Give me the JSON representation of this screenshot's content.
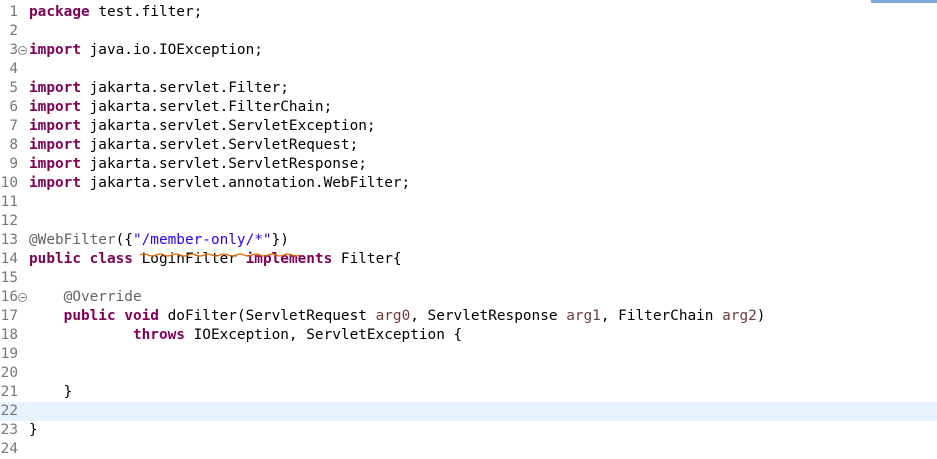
{
  "editor": {
    "lines": [
      {
        "num": "1",
        "fold": false,
        "tokens": [
          {
            "t": "package",
            "c": "kw"
          },
          {
            "t": " test.filter;",
            "c": "plain"
          }
        ]
      },
      {
        "num": "2",
        "fold": false,
        "tokens": []
      },
      {
        "num": "3",
        "fold": true,
        "tokens": [
          {
            "t": "import",
            "c": "kw"
          },
          {
            "t": " java.io.IOException;",
            "c": "plain"
          }
        ]
      },
      {
        "num": "4",
        "fold": false,
        "tokens": []
      },
      {
        "num": "5",
        "fold": false,
        "tokens": [
          {
            "t": "import",
            "c": "kw"
          },
          {
            "t": " jakarta.servlet.Filter;",
            "c": "plain"
          }
        ]
      },
      {
        "num": "6",
        "fold": false,
        "tokens": [
          {
            "t": "import",
            "c": "kw"
          },
          {
            "t": " jakarta.servlet.FilterChain;",
            "c": "plain"
          }
        ]
      },
      {
        "num": "7",
        "fold": false,
        "tokens": [
          {
            "t": "import",
            "c": "kw"
          },
          {
            "t": " jakarta.servlet.ServletException;",
            "c": "plain"
          }
        ]
      },
      {
        "num": "8",
        "fold": false,
        "tokens": [
          {
            "t": "import",
            "c": "kw"
          },
          {
            "t": " jakarta.servlet.ServletRequest;",
            "c": "plain"
          }
        ]
      },
      {
        "num": "9",
        "fold": false,
        "tokens": [
          {
            "t": "import",
            "c": "kw"
          },
          {
            "t": " jakarta.servlet.ServletResponse;",
            "c": "plain"
          }
        ]
      },
      {
        "num": "10",
        "fold": false,
        "tokens": [
          {
            "t": "import",
            "c": "kw"
          },
          {
            "t": " jakarta.servlet.annotation.WebFilter;",
            "c": "plain"
          }
        ]
      },
      {
        "num": "11",
        "fold": false,
        "tokens": []
      },
      {
        "num": "12",
        "fold": false,
        "tokens": []
      },
      {
        "num": "13",
        "fold": false,
        "tokens": [
          {
            "t": "@WebFilter",
            "c": "ann"
          },
          {
            "t": "({",
            "c": "plain"
          },
          {
            "t": "\"/member-only/*\"",
            "c": "str"
          },
          {
            "t": "})",
            "c": "plain"
          }
        ]
      },
      {
        "num": "14",
        "fold": false,
        "tokens": [
          {
            "t": "public",
            "c": "kw"
          },
          {
            "t": " ",
            "c": "plain"
          },
          {
            "t": "class",
            "c": "kw"
          },
          {
            "t": " LoginFilter ",
            "c": "plain"
          },
          {
            "t": "implements",
            "c": "kw"
          },
          {
            "t": " Filter{",
            "c": "plain"
          }
        ]
      },
      {
        "num": "15",
        "fold": false,
        "tokens": []
      },
      {
        "num": "16",
        "fold": true,
        "tokens": [
          {
            "t": "    ",
            "c": "plain"
          },
          {
            "t": "@Override",
            "c": "ann"
          }
        ]
      },
      {
        "num": "17",
        "fold": false,
        "tokens": [
          {
            "t": "    ",
            "c": "plain"
          },
          {
            "t": "public",
            "c": "kw"
          },
          {
            "t": " ",
            "c": "plain"
          },
          {
            "t": "void",
            "c": "kw"
          },
          {
            "t": " doFilter(ServletRequest ",
            "c": "plain"
          },
          {
            "t": "arg0",
            "c": "param"
          },
          {
            "t": ", ServletResponse ",
            "c": "plain"
          },
          {
            "t": "arg1",
            "c": "param"
          },
          {
            "t": ", FilterChain ",
            "c": "plain"
          },
          {
            "t": "arg2",
            "c": "param"
          },
          {
            "t": ")",
            "c": "plain"
          }
        ]
      },
      {
        "num": "18",
        "fold": false,
        "tokens": [
          {
            "t": "            ",
            "c": "plain"
          },
          {
            "t": "throws",
            "c": "kw"
          },
          {
            "t": " IOException, ServletException {",
            "c": "plain"
          }
        ]
      },
      {
        "num": "19",
        "fold": false,
        "tokens": []
      },
      {
        "num": "20",
        "fold": false,
        "tokens": []
      },
      {
        "num": "21",
        "fold": false,
        "tokens": [
          {
            "t": "    }",
            "c": "plain"
          }
        ]
      },
      {
        "num": "22",
        "fold": false,
        "current": true,
        "tokens": []
      },
      {
        "num": "23",
        "fold": false,
        "tokens": [
          {
            "t": "}",
            "c": "plain"
          }
        ]
      },
      {
        "num": "24",
        "fold": false,
        "tokens": []
      }
    ]
  },
  "colors": {
    "keyword": "#7f0055",
    "annotation": "#646464",
    "string": "#2a00ff",
    "parameter": "#6a3e3e",
    "line_number": "#787878",
    "current_line": "#e8f2fe",
    "warning_squiggle": "#e06c00"
  }
}
